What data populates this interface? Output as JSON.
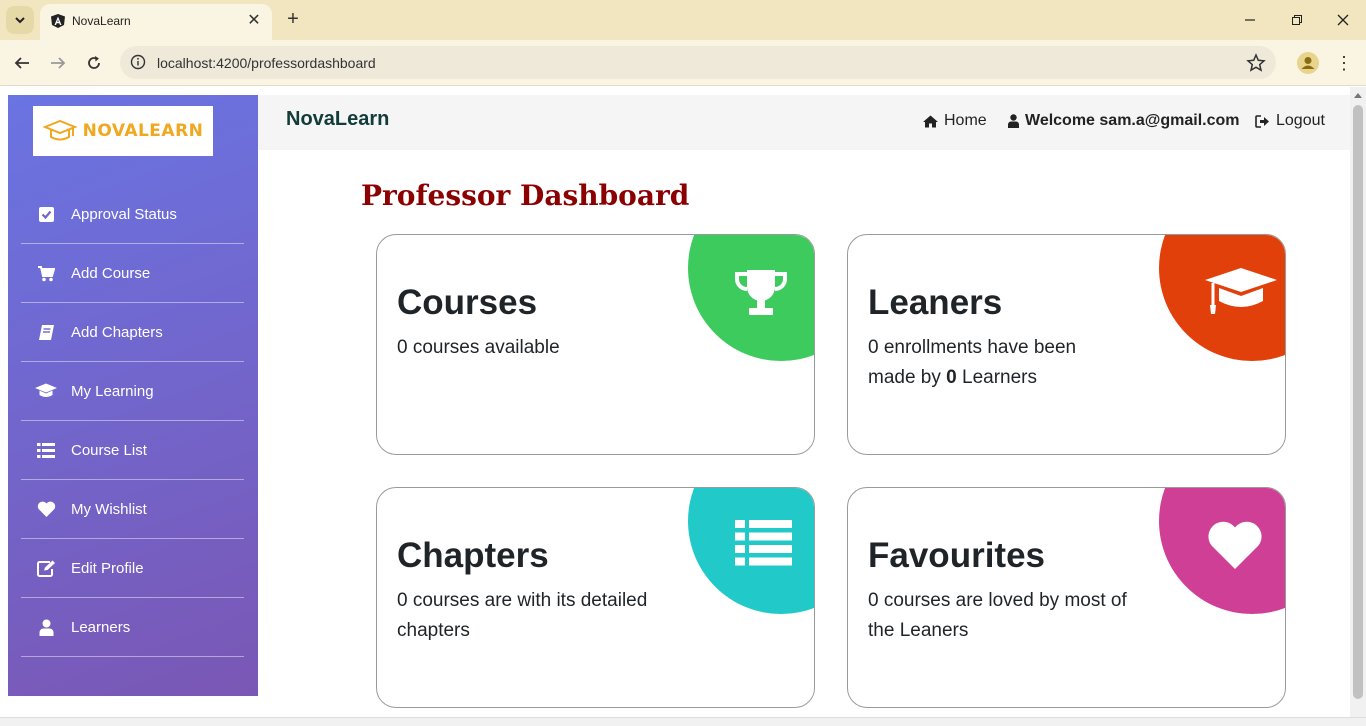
{
  "browser": {
    "tab_title": "NovaLearn",
    "url": "localhost:4200/professordashboard"
  },
  "sidebar": {
    "logo_text": "NOVALEARN",
    "items": [
      {
        "label": "Approval Status",
        "icon": "check-square-icon"
      },
      {
        "label": "Add Course",
        "icon": "cart-icon"
      },
      {
        "label": "Add Chapters",
        "icon": "book-icon"
      },
      {
        "label": "My Learning",
        "icon": "graduation-cap-icon"
      },
      {
        "label": "Course List",
        "icon": "list-icon"
      },
      {
        "label": "My Wishlist",
        "icon": "heart-icon"
      },
      {
        "label": "Edit Profile",
        "icon": "edit-icon"
      },
      {
        "label": "Learners",
        "icon": "user-icon"
      }
    ]
  },
  "topnav": {
    "brand": "NovaLearn",
    "home": "Home",
    "welcome": "Welcome sam.a@gmail.com",
    "logout": "Logout"
  },
  "main": {
    "title": "Professor Dashboard",
    "cards": [
      {
        "title": "Courses",
        "text": "0 courses available",
        "color": "#3ecb5e",
        "icon": "trophy-icon"
      },
      {
        "title": "Leaners",
        "text_before": "0 enrollments have been made by ",
        "text_bold": "0",
        "text_after": " Learners",
        "color": "#e2400a",
        "icon": "graduation-cap-icon"
      },
      {
        "title": "Chapters",
        "text": "0 courses are with its detailed chapters",
        "color": "#22c9c9",
        "icon": "list-icon"
      },
      {
        "title": "Favourites",
        "text": "0 courses are loved by most of the Leaners",
        "color": "#cf3f96",
        "icon": "heart-icon"
      }
    ]
  }
}
